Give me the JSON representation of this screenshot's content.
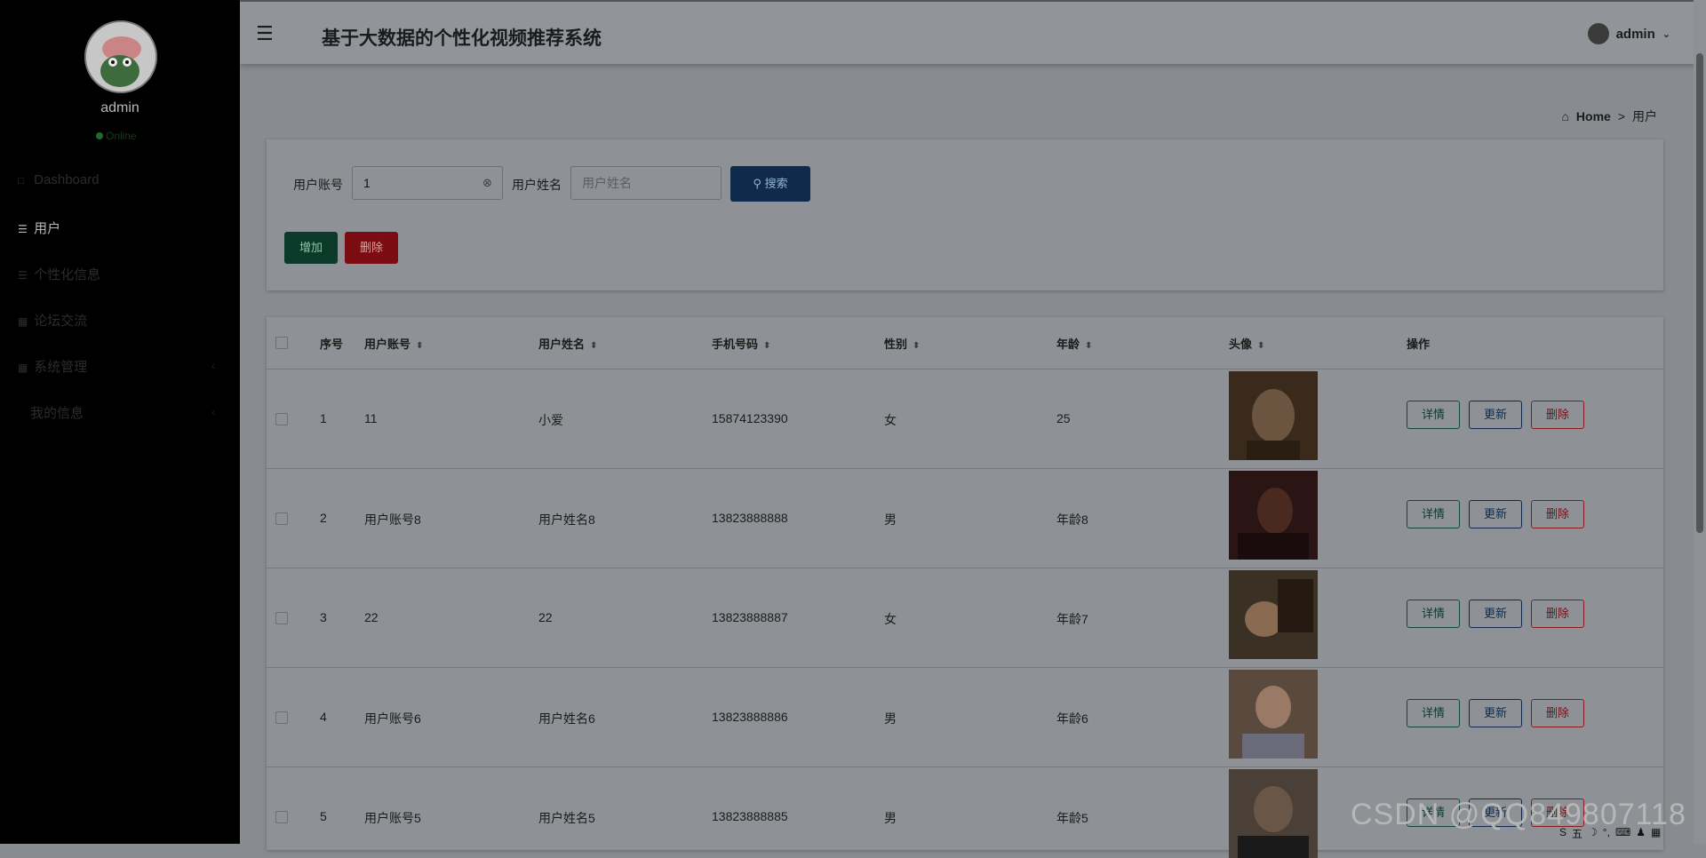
{
  "colors": {
    "sidebar": "#000000",
    "primary": "#0f2a4a",
    "success": "#0b3a2b",
    "danger": "#7a0c12",
    "overlay_bg": "#888c90"
  },
  "sidebar": {
    "username": "admin",
    "status": "Online",
    "items": [
      {
        "label": "Dashboard",
        "icon": "dashboard-icon"
      },
      {
        "label": "用户",
        "icon": "list-icon"
      },
      {
        "label": "个性化信息",
        "icon": "list-icon"
      },
      {
        "label": "论坛交流",
        "icon": "grid-icon"
      },
      {
        "label": "系统管理",
        "icon": "grid-icon"
      },
      {
        "label": "我的信息",
        "icon": "none"
      }
    ]
  },
  "header": {
    "title": "基于大数据的个性化视频推荐系统",
    "user": "admin"
  },
  "breadcrumb": {
    "home": "Home",
    "separator": ">",
    "current": "用户"
  },
  "search": {
    "account_label": "用户账号",
    "account_value": "1",
    "name_label": "用户姓名",
    "name_placeholder": "用户姓名",
    "search_button": "搜索",
    "add_button": "增加",
    "delete_button": "删除"
  },
  "table": {
    "headers": [
      "序号",
      "用户账号",
      "用户姓名",
      "手机号码",
      "性别",
      "年龄",
      "头像",
      "操作"
    ],
    "actions": {
      "detail": "详情",
      "update": "更新",
      "delete": "删除"
    },
    "rows": [
      {
        "index": "1",
        "account": "11",
        "name": "小爱",
        "phone": "15874123390",
        "gender": "女",
        "age": "25"
      },
      {
        "index": "2",
        "account": "用户账号8",
        "name": "用户姓名8",
        "phone": "13823888888",
        "gender": "男",
        "age": "年龄8"
      },
      {
        "index": "3",
        "account": "22",
        "name": "22",
        "phone": "13823888887",
        "gender": "女",
        "age": "年龄7"
      },
      {
        "index": "4",
        "account": "用户账号6",
        "name": "用户姓名6",
        "phone": "13823888886",
        "gender": "男",
        "age": "年龄6"
      },
      {
        "index": "5",
        "account": "用户账号5",
        "name": "用户姓名5",
        "phone": "13823888885",
        "gender": "男",
        "age": "年龄5"
      }
    ]
  },
  "watermark": "CSDN @QQ849807118",
  "tray": [
    "S",
    "五",
    "☽",
    "°,",
    "⌨",
    "♟",
    "▦"
  ]
}
